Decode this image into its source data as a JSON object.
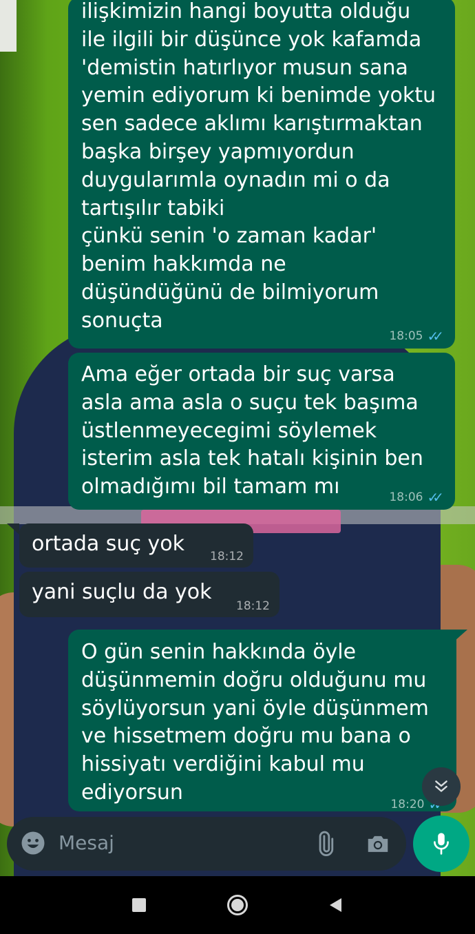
{
  "messages": [
    {
      "direction": "outgoing",
      "lines": [
        "ilişkimizin hangi boyutta olduğu",
        "ile ilgili bir düşünce yok kafamda",
        "'demistin hatırlıyor musun sana",
        "yemin ediyorum ki benimde yoktu",
        "sen sadece aklımı karıştırmaktan",
        "başka birşey yapmıyordun",
        "duygularımla oynadın mi o da",
        "tartışılır tabiki",
        "çünkü senin 'o zaman kadar'",
        "benim hakkımda ne",
        "düşündüğünü de bilmiyorum",
        "sonuçta"
      ],
      "time": "18:05",
      "status": "read"
    },
    {
      "direction": "outgoing",
      "lines": [
        "Ama eğer ortada bir suç varsa",
        "asla ama asla o suçu tek başıma",
        "üstlenmeyecegimi söylemek",
        "isterim asla tek hatalı kişinin ben",
        "olmadığımı bil tamam mı"
      ],
      "time": "18:06",
      "status": "read"
    },
    {
      "direction": "incoming",
      "lines": [
        "ortada suç yok"
      ],
      "time": "18:12"
    },
    {
      "direction": "incoming",
      "lines": [
        "yani suçlu da yok"
      ],
      "time": "18:12"
    },
    {
      "direction": "outgoing",
      "lines": [
        "O gün senin hakkında öyle",
        "düşünmemin doğru olduğunu mu",
        "söylüyorsun yani öyle düşünmem",
        "ve hissetmem doğru mu bana o",
        "hissiyatı verdiğini kabul mu",
        "ediyorsun"
      ],
      "time": "18:20",
      "status": "read"
    }
  ],
  "composer": {
    "placeholder": "Mesaj",
    "icons": [
      "emoji-icon",
      "attach-icon",
      "camera-icon"
    ],
    "mic_icon": "mic-icon"
  },
  "scroll_button_icon": "double-chevron-down-icon",
  "nav_icons": [
    "recents-icon",
    "home-icon",
    "back-icon"
  ],
  "colors": {
    "outgoing_bubble": "#005c4b",
    "incoming_bubble": "#202c33",
    "read_ticks": "#53bdeb",
    "mic_button": "#00a884",
    "composer_bg": "#202c33"
  }
}
